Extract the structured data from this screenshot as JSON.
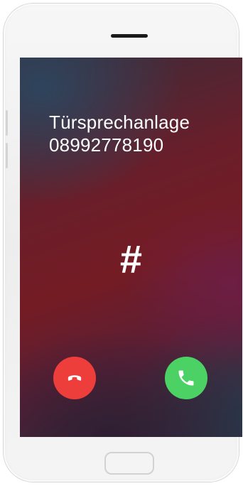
{
  "call": {
    "caller_name": "Türsprechanlage",
    "caller_number": "08992778190",
    "dtmf_display": "#"
  },
  "actions": {
    "decline_icon": "phone-hangup-icon",
    "accept_icon": "phone-icon"
  },
  "colors": {
    "decline": "#ee3e3b",
    "accept": "#4cd264",
    "screen_background": "#6a1e2a"
  }
}
